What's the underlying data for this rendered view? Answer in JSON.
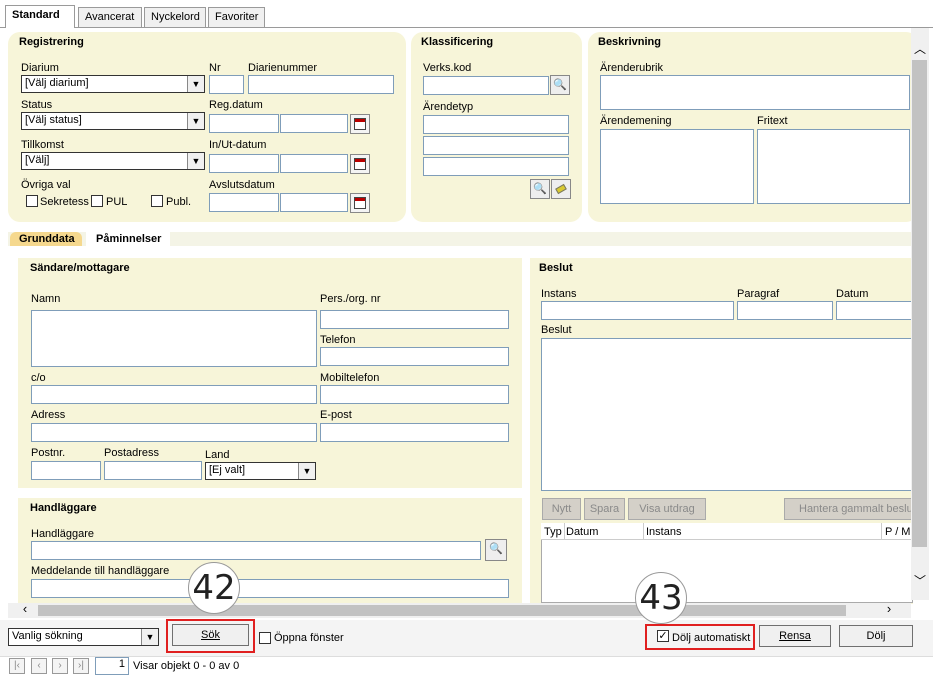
{
  "tabs": [
    "Standard",
    "Avancerat",
    "Nyckelord",
    "Favoriter"
  ],
  "registrering": {
    "title": "Registrering",
    "diarium_label": "Diarium",
    "diarium_value": "[Välj diarium]",
    "nr_label": "Nr",
    "diarienummer_label": "Diarienummer",
    "status_label": "Status",
    "status_value": "[Välj status]",
    "regdatum_label": "Reg.datum",
    "tillkomst_label": "Tillkomst",
    "tillkomst_value": "[Välj]",
    "inut_label": "In/Ut-datum",
    "ovriga_label": "Övriga val",
    "sekretess": "Sekretess",
    "pul": "PUL",
    "publ": "Publ.",
    "avslut_label": "Avslutsdatum"
  },
  "klassificering": {
    "title": "Klassificering",
    "verkskod_label": "Verks.kod",
    "arendetyp_label": "Ärendetyp"
  },
  "beskrivning": {
    "title": "Beskrivning",
    "rubrik_label": "Ärenderubrik",
    "mening_label": "Ärendemening",
    "fritext_label": "Fritext"
  },
  "subtabs": [
    "Grunddata",
    "Påminnelser"
  ],
  "sandare": {
    "title": "Sändare/mottagare",
    "namn": "Namn",
    "pers": "Pers./org. nr",
    "telefon": "Telefon",
    "co": "c/o",
    "mobil": "Mobiltelefon",
    "adress": "Adress",
    "epost": "E-post",
    "postnr": "Postnr.",
    "postadress": "Postadress",
    "land": "Land",
    "land_value": "[Ej valt]"
  },
  "handlaggare": {
    "title": "Handläggare",
    "label": "Handläggare",
    "meddelande": "Meddelande till handläggare"
  },
  "beslut": {
    "title": "Beslut",
    "instans": "Instans",
    "paragraf": "Paragraf",
    "datum": "Datum",
    "beslut_label": "Beslut",
    "btn_nytt": "Nytt",
    "btn_spara": "Spara",
    "btn_visa": "Visa utdrag",
    "btn_hantera": "Hantera gammalt beslut",
    "col_typ": "Typ",
    "col_datum": "Datum",
    "col_instans": "Instans",
    "col_pm": "P / M"
  },
  "bottom": {
    "search_mode": "Vanlig sökning",
    "sok": "Sök",
    "oppna": "Öppna fönster",
    "dolj_auto": "Dölj automatiskt",
    "dolj_auto_checked": true,
    "rensa": "Rensa",
    "dolj": "Dölj",
    "page": "1",
    "visar": "Visar objekt 0 - 0 av 0"
  },
  "markers": {
    "m42": "42",
    "m43": "43"
  },
  "colors": {
    "panel": "#f7f5d9",
    "highlight": "#e02020",
    "tab_active": "#f5d88e"
  }
}
